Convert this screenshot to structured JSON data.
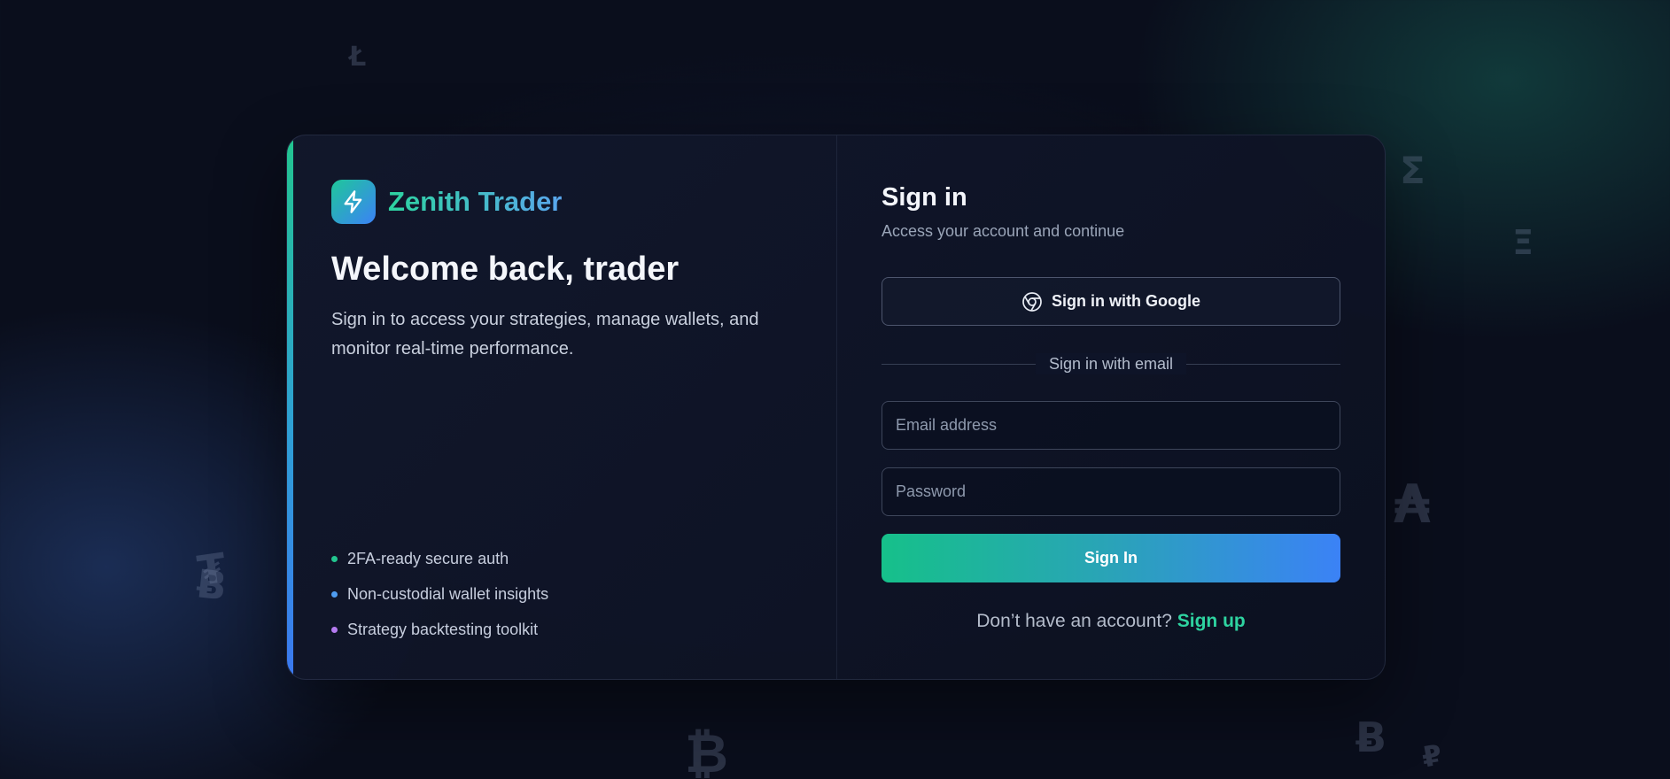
{
  "brand": {
    "name": "Zenith Trader",
    "logo_icon": "lightning-bolt-icon"
  },
  "welcome": {
    "title": "Welcome back, trader",
    "subtitle": "Sign in to access your strategies, manage wallets, and monitor real-time performance."
  },
  "features": [
    {
      "label": "2FA-ready secure auth",
      "color": "#22c58f"
    },
    {
      "label": "Non-custodial wallet insights",
      "color": "#4f9cf0"
    },
    {
      "label": "Strategy backtesting toolkit",
      "color": "#b57bf0"
    }
  ],
  "signin": {
    "title": "Sign in",
    "subtitle": "Access your account and continue",
    "google_button_label": "Sign in with Google",
    "google_icon": "chrome-icon",
    "divider_label": "Sign in with email",
    "email_placeholder": "Email address",
    "password_placeholder": "Password",
    "submit_label": "Sign In",
    "no_account_text": "Don’t have an account?",
    "signup_label": "Sign up"
  },
  "background_glyphs": [
    "Ł",
    "Ʃ",
    "Ξ",
    "₳",
    "₮",
    "Ƀ",
    "₿",
    "Ƀ",
    "₽"
  ],
  "colors": {
    "accent_green": "#22c58f",
    "accent_blue": "#3b82f6",
    "background": "#0a0e1c"
  }
}
